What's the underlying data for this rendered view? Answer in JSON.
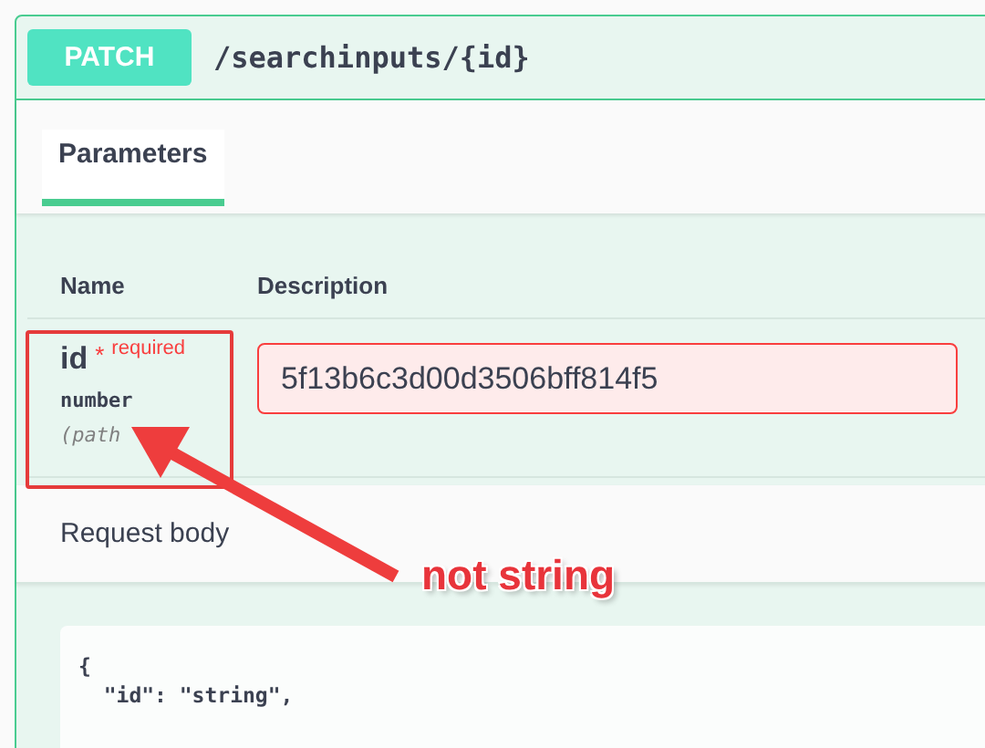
{
  "operation": {
    "method": "PATCH",
    "path": "/searchinputs/{id}"
  },
  "tabs": [
    {
      "label": "Parameters",
      "selected": true
    }
  ],
  "parameters": {
    "columns": [
      "Name",
      "Description"
    ],
    "rows": [
      {
        "name": "id",
        "required_mark": "*",
        "required_label": "required",
        "type": "number",
        "location": "(path",
        "value": "5f13b6c3d00d3506bff814f5",
        "invalid": true
      }
    ]
  },
  "request_body": {
    "title": "Request body",
    "example_lines": [
      "{",
      "  \"id\": \"string\","
    ]
  },
  "annotation": {
    "text": "not string"
  }
}
